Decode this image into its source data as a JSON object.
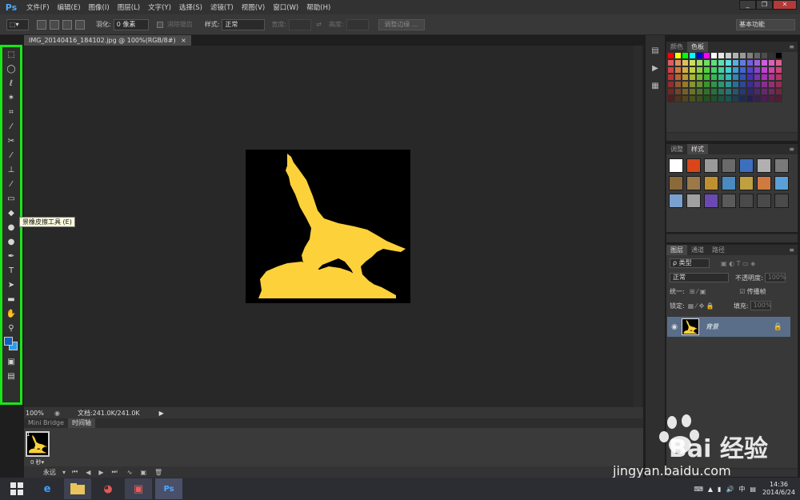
{
  "app": {
    "logo": "Ps",
    "menu": [
      "文件(F)",
      "编辑(E)",
      "图像(I)",
      "图层(L)",
      "文字(Y)",
      "选择(S)",
      "滤镜(T)",
      "视图(V)",
      "窗口(W)",
      "帮助(H)"
    ],
    "window_controls": [
      "_",
      "❐",
      "✕"
    ]
  },
  "options": {
    "feather_label": "羽化:",
    "feather_value": "0 像素",
    "antialias_label": "消除锯齿",
    "style_label": "样式:",
    "style_value": "正常",
    "width_label": "宽度:",
    "height_label": "高度:",
    "refine_edge": "调整边缘 ...",
    "workspace": "基本功能"
  },
  "tools": {
    "icons": [
      "move-icon",
      "marquee-icon",
      "lasso-icon",
      "quick-select-icon",
      "crop-icon",
      "eyedropper-icon",
      "healing-icon",
      "brush-icon",
      "stamp-icon",
      "history-brush-icon",
      "eraser-icon",
      "gradient-icon",
      "blur-icon",
      "dodge-icon",
      "pen-icon",
      "type-icon",
      "path-select-icon",
      "shape-icon",
      "hand-icon",
      "zoom-icon"
    ],
    "tooltip": "景橡皮擦工具 (E)",
    "foreground_color": "#0f5ec2",
    "background_color": "#2a9df0"
  },
  "document": {
    "tab_title": "IMG_20140416_184102.jpg @ 100%(RGB/8#)",
    "tab_close": "×",
    "canvas_bg": "#000000",
    "figure_color": "#fdd13a"
  },
  "status": {
    "zoom": "100%",
    "doc_info": "文档:241.0K/241.0K"
  },
  "timeline": {
    "tabs": [
      "Mini Bridge",
      "时间轴"
    ],
    "frame_number": "1",
    "frame_delay": "0 秒▾",
    "loop": "永远"
  },
  "panels": {
    "color_tabs": [
      "颜色",
      "色板"
    ],
    "adjust_tabs": [
      "调整",
      "样式"
    ],
    "layer_tabs": [
      "图层",
      "通道",
      "路径"
    ],
    "filter_kind": "ρ 类型",
    "blend_mode": "正常",
    "opacity_label": "不透明度:",
    "opacity_value": "100%",
    "unify_label": "统一:",
    "propagate_label": "传播帧",
    "lock_label": "锁定:",
    "fill_label": "填充:",
    "fill_value": "100%",
    "layer_name": "背景"
  },
  "taskbar": {
    "time": "14:36",
    "date": "2014/6/24",
    "ime": "中"
  },
  "watermark": {
    "text": "Bai 经验",
    "url": "jingyan.baidu.com"
  }
}
